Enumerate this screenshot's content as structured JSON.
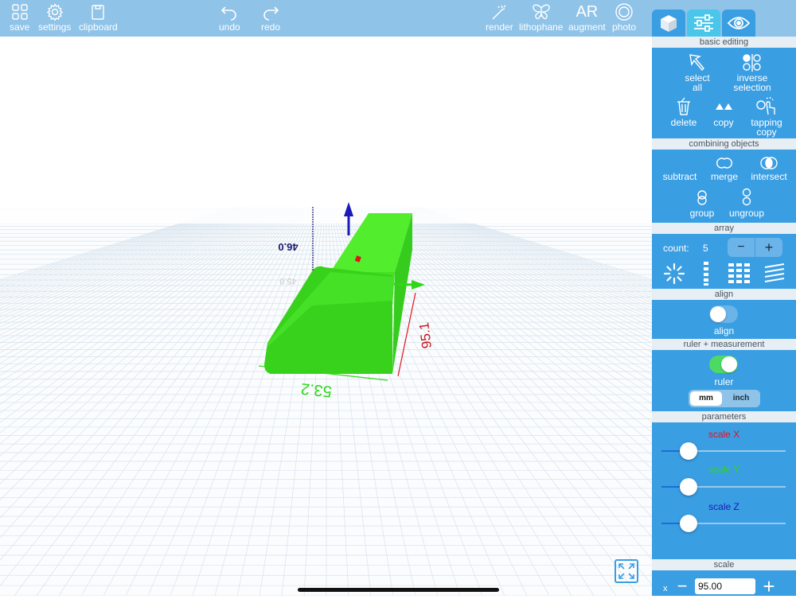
{
  "toolbar": {
    "save": "save",
    "settings": "settings",
    "clipboard": "clipboard",
    "undo": "undo",
    "redo": "redo",
    "render": "render",
    "lithophane": "lithophane",
    "augment": "augment",
    "augment_icon_text": "AR",
    "photo": "photo"
  },
  "viewport": {
    "width_label": "53.2",
    "depth_label": "95.1",
    "height_label": "46.0",
    "ghost_label": "45.0"
  },
  "panel": {
    "basic_editing": {
      "header": "basic editing",
      "select_all": "select all",
      "inverse_selection": "inverse selection",
      "delete": "delete",
      "copy": "copy",
      "tapping_copy": "tapping copy"
    },
    "combining": {
      "header": "combining objects",
      "subtract": "subtract",
      "merge": "merge",
      "intersect": "intersect",
      "group": "group",
      "ungroup": "ungroup"
    },
    "array": {
      "header": "array",
      "count_label": "count:",
      "count_value": "5",
      "minus": "−",
      "plus": "+"
    },
    "align": {
      "header": "align",
      "label": "align",
      "enabled": false
    },
    "ruler": {
      "header": "ruler + measurement",
      "label": "ruler",
      "enabled": true,
      "unit_mm": "mm",
      "unit_inch": "inch",
      "selected_unit": "mm"
    },
    "parameters": {
      "header": "parameters",
      "scale_x": "scale X",
      "scale_y": "scale Y",
      "scale_z": "scale Z",
      "scale_x_fraction": 0.22,
      "scale_y_fraction": 0.22,
      "scale_z_fraction": 0.22
    },
    "scale": {
      "header": "scale",
      "axis": "x",
      "value": "95.00",
      "minus": "−",
      "plus": "+"
    }
  },
  "colors": {
    "toolbar": "#8fc3e8",
    "panel": "#3a9ee3",
    "object_green": "#3ddb1f",
    "x_axis": "#e0141e",
    "y_axis": "#2fd61a",
    "z_axis": "#1a1ab8",
    "toggle_on": "#4cd964"
  }
}
